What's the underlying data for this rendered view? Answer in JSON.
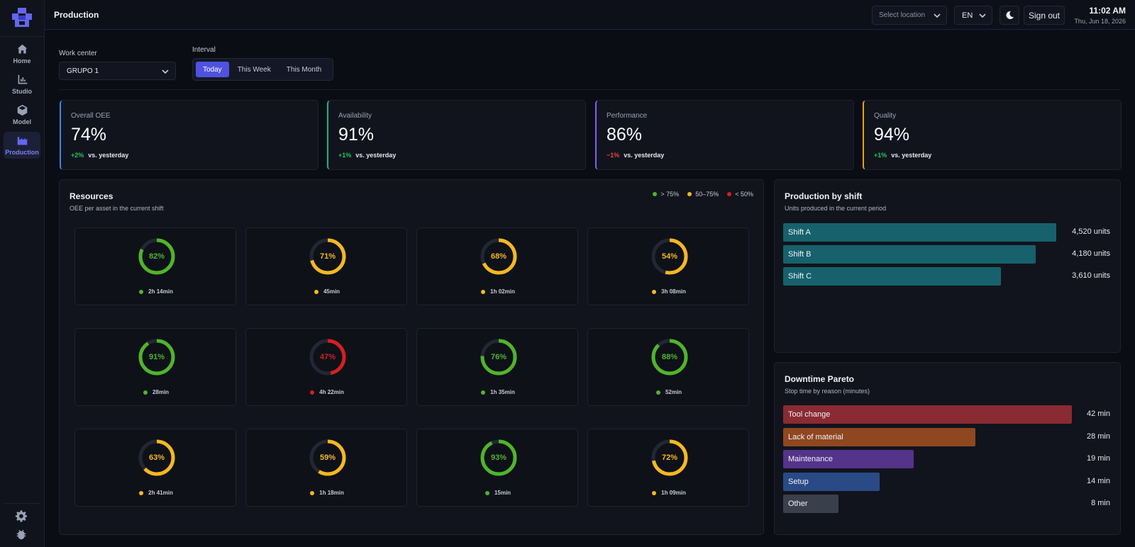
{
  "header": {
    "title": "Production",
    "location_placeholder": "Select location",
    "language": "EN",
    "signout_label": "Sign out",
    "time": "11:02 AM",
    "date": "Thu, Jun 18, 2026"
  },
  "sidebar": {
    "items": [
      {
        "label": "Home",
        "icon": "home-icon",
        "active": false
      },
      {
        "label": "Studio",
        "icon": "chart-icon",
        "active": false
      },
      {
        "label": "Model",
        "icon": "cube-icon",
        "active": false
      },
      {
        "label": "Production",
        "icon": "factory-icon",
        "active": true
      }
    ],
    "bottom_icons": [
      "gear-icon",
      "bug-icon"
    ]
  },
  "filters": {
    "work_center_label": "Work center",
    "work_center_value": "GRUPO 1",
    "interval_label": "Interval",
    "interval_options": [
      "Today",
      "This Week",
      "This Month"
    ],
    "interval_selected": "Today"
  },
  "kpis": [
    {
      "label": "Overall OEE",
      "value": "74%",
      "delta": "+2%",
      "vs": "vs. yesterday",
      "accent": "#3b82f6",
      "delta_color": "#22c55e"
    },
    {
      "label": "Availability",
      "value": "91%",
      "delta": "+1%",
      "vs": "vs. yesterday",
      "accent": "#10b981",
      "delta_color": "#22c55e"
    },
    {
      "label": "Performance",
      "value": "86%",
      "delta": "−1%",
      "vs": "vs. yesterday",
      "accent": "#8b5cf6",
      "delta_color": "#ef4444"
    },
    {
      "label": "Quality",
      "value": "94%",
      "delta": "+1%",
      "vs": "vs. yesterday",
      "accent": "#f59e0b",
      "delta_color": "#22c55e"
    }
  ],
  "resources": {
    "title": "Resources",
    "subtitle": "OEE per asset in the current shift",
    "legend": [
      {
        "label": "> 75%",
        "color": "#4fb52a"
      },
      {
        "label": "50–75%",
        "color": "#f5b820"
      },
      {
        "label": "< 50%",
        "color": "#d61f1f"
      }
    ],
    "items": [
      {
        "oee": 82,
        "time": "2h 14min",
        "color": "#4fb52a"
      },
      {
        "oee": 71,
        "time": "45min",
        "color": "#f5b820"
      },
      {
        "oee": 68,
        "time": "1h 02min",
        "color": "#f5b820"
      },
      {
        "oee": 54,
        "time": "3h 08min",
        "color": "#f5b820"
      },
      {
        "oee": 91,
        "time": "28min",
        "color": "#4fb52a"
      },
      {
        "oee": 47,
        "time": "4h 22min",
        "color": "#d61f1f"
      },
      {
        "oee": 76,
        "time": "1h 35min",
        "color": "#4fb52a"
      },
      {
        "oee": 88,
        "time": "52min",
        "color": "#4fb52a"
      },
      {
        "oee": 63,
        "time": "2h 41min",
        "color": "#f5b820"
      },
      {
        "oee": 59,
        "time": "1h 18min",
        "color": "#f5b820"
      },
      {
        "oee": 93,
        "time": "15min",
        "color": "#4fb52a"
      },
      {
        "oee": 72,
        "time": "1h 09min",
        "color": "#f5b820"
      }
    ]
  },
  "production_by_shift": {
    "title": "Production by shift",
    "subtitle": "Units produced in the current period",
    "chart_data": {
      "type": "bar",
      "categories": [
        "Shift A",
        "Shift B",
        "Shift C"
      ],
      "values": [
        4520,
        4180,
        3610
      ],
      "value_labels": [
        "4,520 units",
        "4,180 units",
        "3,610 units"
      ],
      "color": "#17616c",
      "max": 4520
    }
  },
  "downtime_pareto": {
    "title": "Downtime Pareto",
    "subtitle": "Stop time by reason (minutes)",
    "chart_data": {
      "type": "bar",
      "categories": [
        "Tool change",
        "Lack of material",
        "Maintenance",
        "Setup",
        "Other"
      ],
      "values": [
        42,
        28,
        19,
        14,
        8
      ],
      "value_labels": [
        "42 min",
        "28 min",
        "19 min",
        "14 min",
        "8 min"
      ],
      "colors": [
        "#8a2a33",
        "#8f4720",
        "#54338a",
        "#2a4a86",
        "#3a3f4c"
      ],
      "max": 42
    }
  }
}
